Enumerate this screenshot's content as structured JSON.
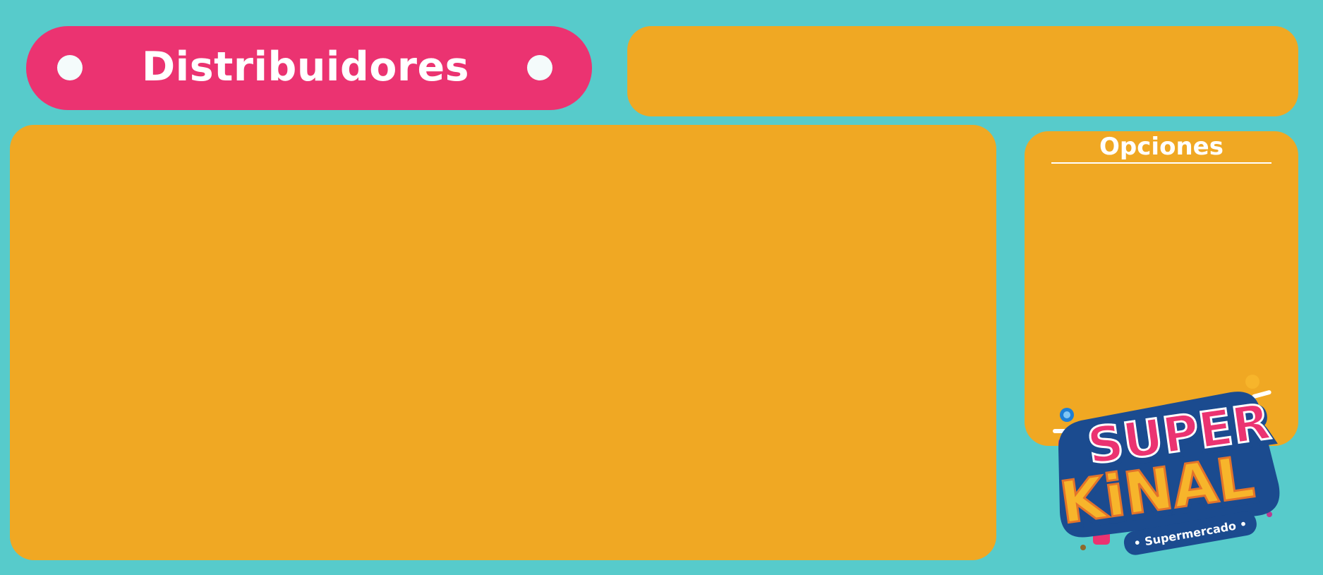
{
  "header": {
    "title": "Distribuidores"
  },
  "options_panel": {
    "title": "Opciones"
  },
  "logo": {
    "line1": "SUPER",
    "line2": "KiNAL",
    "tagline": "• Supermercado •"
  },
  "colors": {
    "background": "#57CBCB",
    "title_pill": "#EB3371",
    "panel": "#F0A823",
    "dot": "#F4FBFB",
    "logo_pink": "#EB3371",
    "logo_yellow": "#F7B52B",
    "logo_blue": "#1B4B8F"
  }
}
